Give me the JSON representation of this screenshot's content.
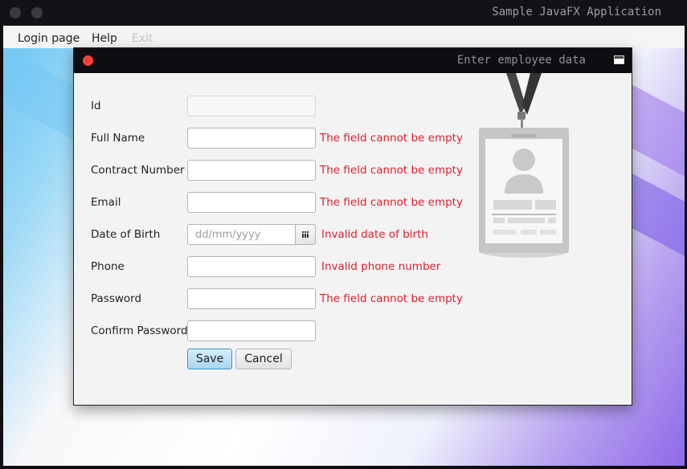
{
  "window": {
    "title": "Sample JavaFX Application"
  },
  "menubar": {
    "items": [
      {
        "label": "Login page",
        "enabled": true
      },
      {
        "label": "Help",
        "enabled": true
      },
      {
        "label": "Exit",
        "enabled": false
      }
    ]
  },
  "dialog": {
    "title": "Enter employee data",
    "badge_icon": "employee-id-badge-icon",
    "fields": {
      "id": {
        "label": "Id",
        "value": "",
        "enabled": false
      },
      "full_name": {
        "label": "Full Name",
        "value": "",
        "error": "The field cannot be empty"
      },
      "contract_number": {
        "label": "Contract Number",
        "value": "",
        "error": "The field cannot be empty"
      },
      "email": {
        "label": "Email",
        "value": "",
        "error": "The field cannot be empty"
      },
      "date_of_birth": {
        "label": "Date of Birth",
        "value": "",
        "placeholder": "dd/mm/yyyy",
        "error": "Invalid date of birth",
        "picker_icon": "calendar-icon"
      },
      "phone": {
        "label": "Phone",
        "value": "",
        "error": "Invalid phone number"
      },
      "password": {
        "label": "Password",
        "value": "",
        "error": "The field cannot be empty"
      },
      "confirm_password": {
        "label": "Confirm Password",
        "value": ""
      }
    },
    "buttons": {
      "save": "Save",
      "cancel": "Cancel"
    }
  },
  "colors": {
    "error_text": "#e01e2b",
    "close_button": "#f4413b",
    "save_button_border": "#3a94c8"
  }
}
